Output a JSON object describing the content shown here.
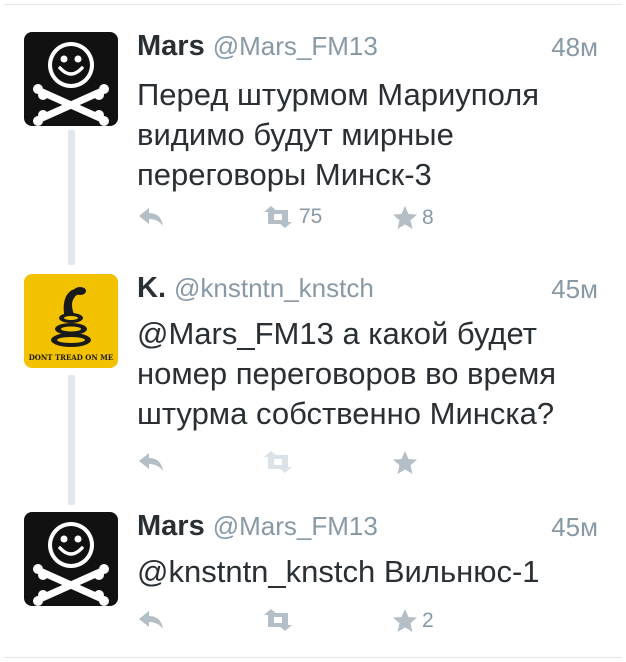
{
  "colors": {
    "name": "#292f33",
    "secondary": "#8899a6",
    "action_icon": "#b3bec6",
    "thread_line": "#e1e8ed",
    "avatar_gadsden_bg": "#f2c200"
  },
  "tweets": [
    {
      "avatar_icon": "jolly-roger-smiley-icon",
      "name": "Mars",
      "handle": "@Mars_FM13",
      "time": "48м",
      "text": "Перед штурмом Мариуполя видимо будут мирные переговоры Минск-3",
      "retweets": "75",
      "favorites": "8"
    },
    {
      "avatar_icon": "gadsden-flag-icon",
      "avatar_caption": "DONT TREAD ON ME",
      "name": "K.",
      "handle": "@knstntn_knstch",
      "time": "45м",
      "text": "@Mars_FM13 а какой будет номер переговоров во время штурма собственно Минска?",
      "retweets": "",
      "favorites": ""
    },
    {
      "avatar_icon": "jolly-roger-smiley-icon",
      "name": "Mars",
      "handle": "@Mars_FM13",
      "time": "45м",
      "text": "@knstntn_knstch Вильнюс-1",
      "retweets": "",
      "favorites": "2"
    }
  ]
}
